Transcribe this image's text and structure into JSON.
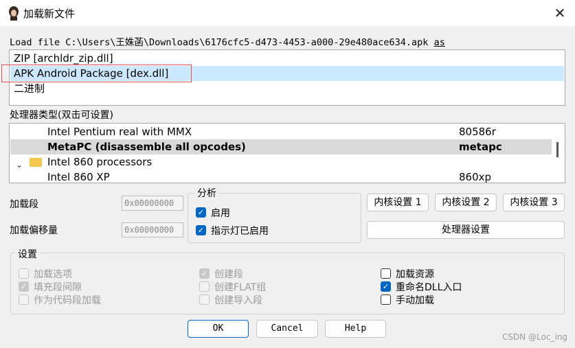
{
  "window": {
    "title": "加载新文件",
    "close_glyph": "✕"
  },
  "load_file": {
    "prefix": "Load file C:\\Users\\王姝菡\\Downloads\\6176cfc5-d473-4453-a000-29e480ace634.apk",
    "suffix": "as"
  },
  "loaders": [
    {
      "label": "ZIP [archldr_zip.dll]",
      "selected": false
    },
    {
      "label": "APK Android Package [dex.dll]",
      "selected": true
    },
    {
      "label": "二进制",
      "selected": false
    }
  ],
  "processor": {
    "label": "处理器类型(双击可设置)",
    "rows": [
      {
        "name": "Intel Pentium real with MMX",
        "code": "80586r"
      },
      {
        "name": "MetaPC (disassemble all opcodes)",
        "code": "metapc"
      },
      {
        "name": "Intel 860 processors",
        "code": ""
      },
      {
        "name": "Intel 860 XP",
        "code": "860xp"
      }
    ],
    "chevron": "⌄"
  },
  "segments": {
    "load_segment_label": "加载段",
    "load_segment_value": "0x00000000",
    "load_offset_label": "加载偏移量",
    "load_offset_value": "0x00000000"
  },
  "analysis": {
    "title": "分析",
    "enable_label": "启用",
    "indicator_label": "指示灯已启用",
    "check_glyph": "✓"
  },
  "buttons": {
    "kernel1": "内核设置 1",
    "kernel2": "内核设置 2",
    "kernel3": "内核设置 3",
    "processor_settings": "处理器设置",
    "ok": "OK",
    "cancel": "Cancel",
    "help": "Help"
  },
  "settings": {
    "title": "设置",
    "load_options": "加载选项",
    "fill_gaps": "填充段间隙",
    "as_code_segment": "作为代码段加载",
    "create_segments": "创建段",
    "create_flat_group": "创建FLAT组",
    "create_import_segment": "创建导入段",
    "load_resources": "加载资源",
    "rename_dll_entries": "重命名DLL入口",
    "manual_load": "手动加载"
  },
  "watermark": "CSDN @Loc_ing"
}
